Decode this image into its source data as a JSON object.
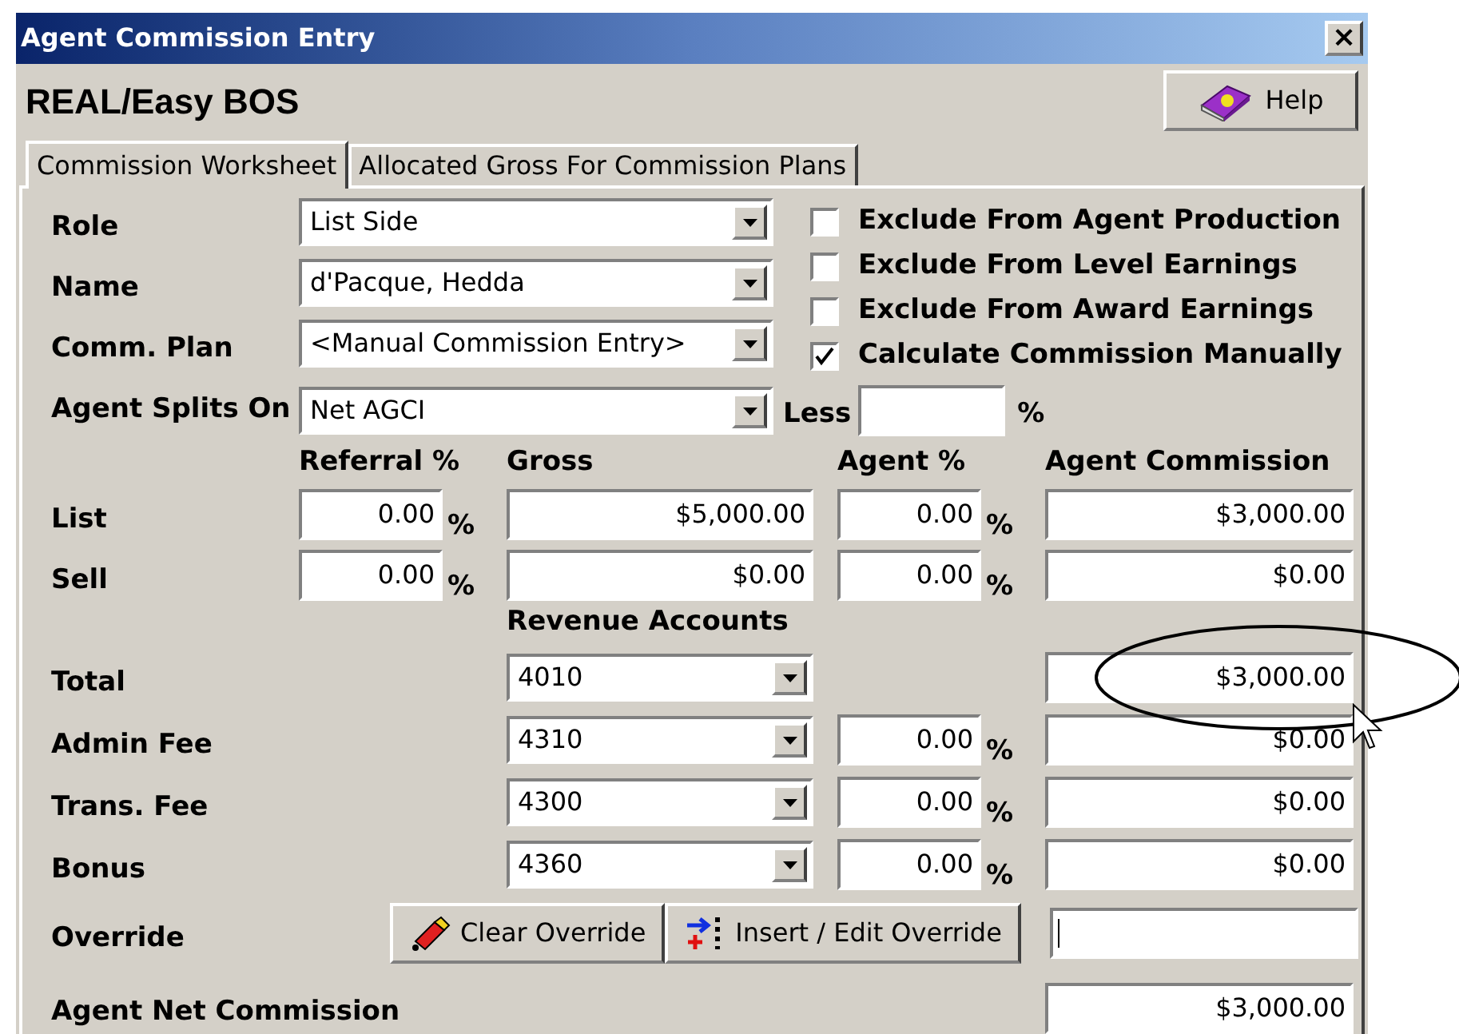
{
  "window": {
    "title": "Agent Commission Entry",
    "close": "×"
  },
  "app_title": "REAL/Easy BOS",
  "help_button": "Help",
  "tabs": [
    {
      "label": "Commission Worksheet",
      "selected": true
    },
    {
      "label": "Allocated Gross For Commission Plans",
      "selected": false
    }
  ],
  "fields": [
    {
      "label": "Role",
      "value": "List Side"
    },
    {
      "label": "Name",
      "value": "d'Pacque, Hedda"
    },
    {
      "label": "Comm. Plan",
      "value": "<Manual Commission Entry>"
    }
  ],
  "checkboxes": [
    {
      "label": "Exclude From Agent Production",
      "checked": false
    },
    {
      "label": "Exclude From Level Earnings",
      "checked": false
    },
    {
      "label": "Exclude From Award Earnings",
      "checked": false
    },
    {
      "label": "Calculate Commission Manually",
      "checked": true
    }
  ],
  "splits": {
    "label": "Agent Splits On",
    "value": "Net AGCI",
    "less_label": "Less",
    "unit": "%"
  },
  "columns": [
    "Referral %",
    "Gross",
    "Agent %",
    "Agent Commission"
  ],
  "side_rows": [
    {
      "label": "List",
      "referral": "0.00",
      "referral_unit": "%",
      "gross": "$5,000.00",
      "agent_pct": "0.00",
      "agent_unit": "%",
      "commission": "$3,000.00"
    },
    {
      "label": "Sell",
      "referral": "0.00",
      "referral_unit": "%",
      "gross": "$0.00",
      "agent_pct": "0.00",
      "agent_unit": "%",
      "commission": "$0.00"
    }
  ],
  "revenue_accounts_label": "Revenue Accounts",
  "account_rows": [
    {
      "label": "Total",
      "account": "4010",
      "commission": "$3,000.00"
    },
    {
      "label": "Admin Fee",
      "account": "4310",
      "agent_pct": "0.00",
      "agent_unit": "%",
      "commission": "$0.00"
    },
    {
      "label": "Trans. Fee",
      "account": "4300",
      "agent_pct": "0.00",
      "agent_unit": "%",
      "commission": "$0.00"
    },
    {
      "label": "Bonus",
      "account": "4360",
      "agent_pct": "0.00",
      "agent_unit": "%",
      "commission": "$0.00"
    }
  ],
  "override": {
    "label": "Override",
    "buttons": [
      "Clear Override",
      "Insert / Edit Override"
    ]
  },
  "net": {
    "label": "Agent Net Commission",
    "value": "$3,000.00"
  }
}
